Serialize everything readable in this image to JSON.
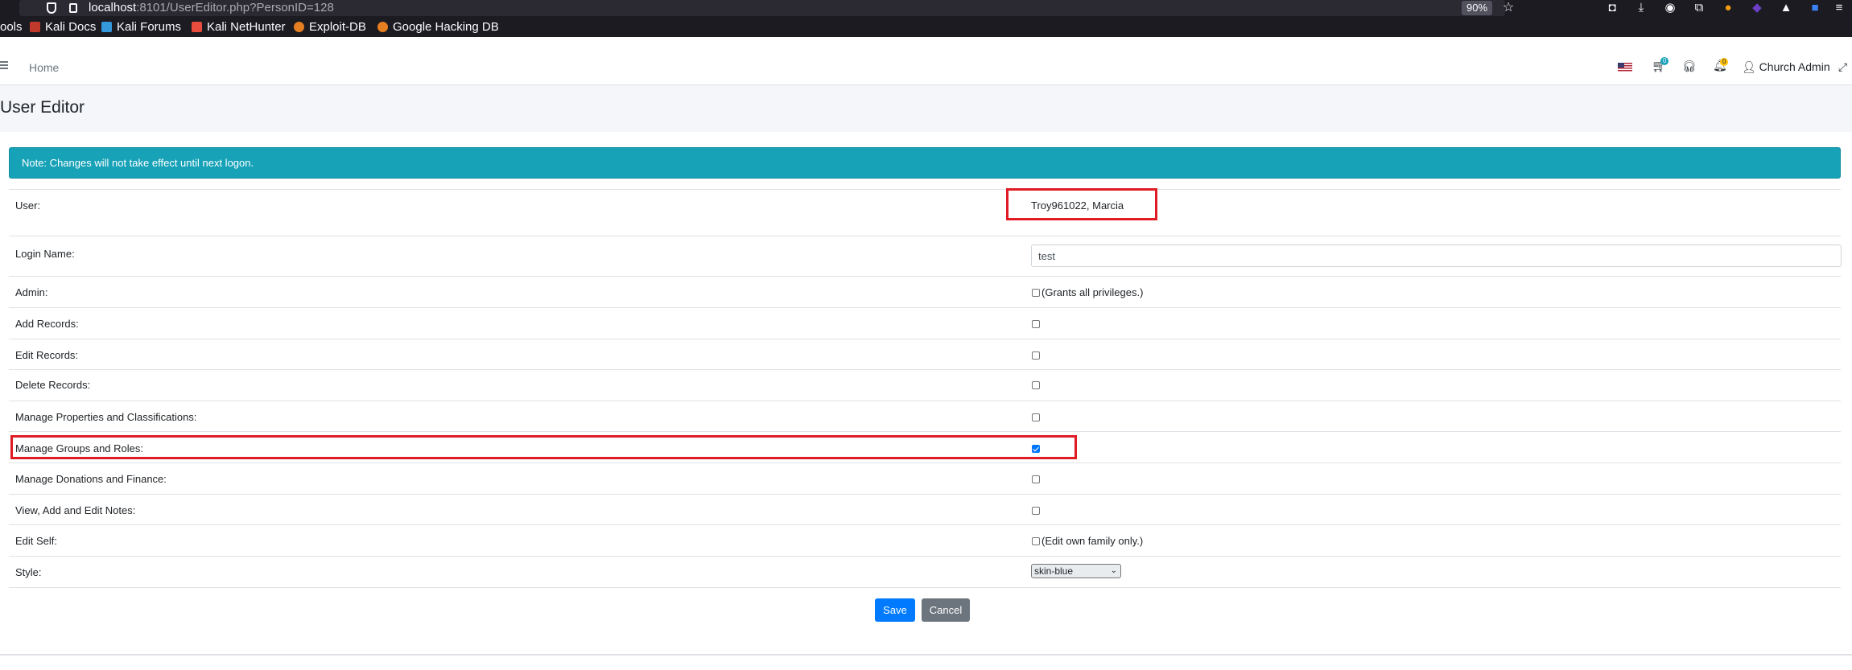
{
  "browser": {
    "url_host": "localhost",
    "url_rest": ":8101/UserEditor.php?PersonID=128",
    "zoom": "90%",
    "bookmarks": [
      {
        "label": "ools",
        "color": ""
      },
      {
        "label": "Kali Docs",
        "color": "#c0392b"
      },
      {
        "label": "Kali Forums",
        "color": "#3498db"
      },
      {
        "label": "Kali NetHunter",
        "color": "#e74c3c"
      },
      {
        "label": "Exploit-DB",
        "color": "#e67e22"
      },
      {
        "label": "Google Hacking DB",
        "color": "#e67e22"
      }
    ]
  },
  "navbar": {
    "home": "Home",
    "cart_count": "0",
    "notification_count": "0",
    "user": "Church Admin"
  },
  "page": {
    "title": "User Editor",
    "note": "Note: Changes will not take effect until next logon."
  },
  "form": {
    "user_label": "User:",
    "user_value": "Troy961022, Marcia",
    "login_label": "Login Name:",
    "login_value": "test",
    "admin_label": "Admin:",
    "admin_hint": "(Grants all privileges.)",
    "add_records_label": "Add Records:",
    "edit_records_label": "Edit Records:",
    "delete_records_label": "Delete Records:",
    "manage_properties_label": "Manage Properties and Classifications:",
    "manage_groups_label": "Manage Groups and Roles:",
    "manage_groups_checked": true,
    "manage_donations_label": "Manage Donations and Finance:",
    "notes_label": "View, Add and Edit Notes:",
    "edit_self_label": "Edit Self:",
    "edit_self_hint": "(Edit own family only.)",
    "style_label": "Style:",
    "style_value": "skin-blue",
    "save_label": "Save",
    "cancel_label": "Cancel"
  },
  "colors": {
    "alert": "#17a2b8",
    "primary": "#007bff",
    "secondary": "#6c757d",
    "highlight": "#e01b24"
  }
}
